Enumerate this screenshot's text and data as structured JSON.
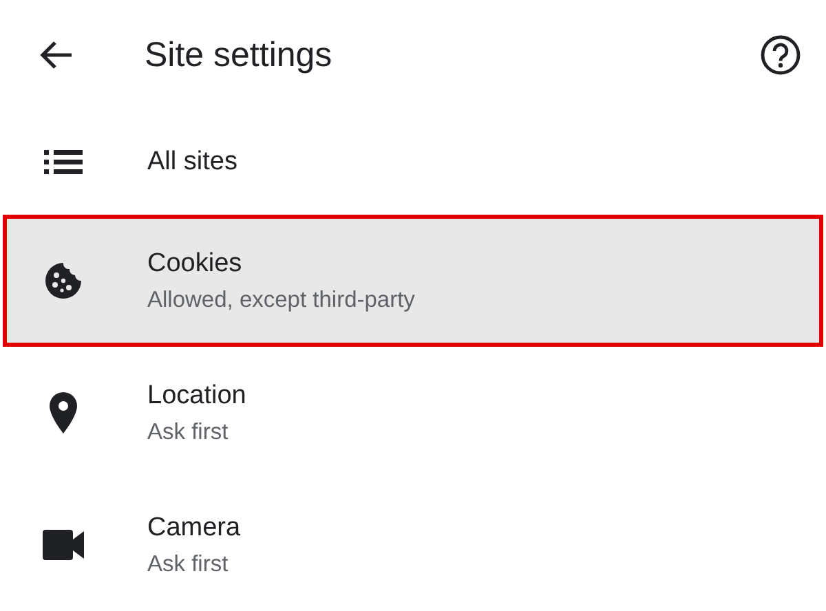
{
  "header": {
    "title": "Site settings"
  },
  "items": [
    {
      "kind": "list",
      "title": "All sites",
      "selected": false
    },
    {
      "kind": "cookie",
      "title": "Cookies",
      "subtitle": "Allowed, except third-party",
      "selected": true
    },
    {
      "kind": "pin",
      "title": "Location",
      "subtitle": "Ask first",
      "selected": false
    },
    {
      "kind": "camera",
      "title": "Camera",
      "subtitle": "Ask first",
      "selected": false
    }
  ]
}
